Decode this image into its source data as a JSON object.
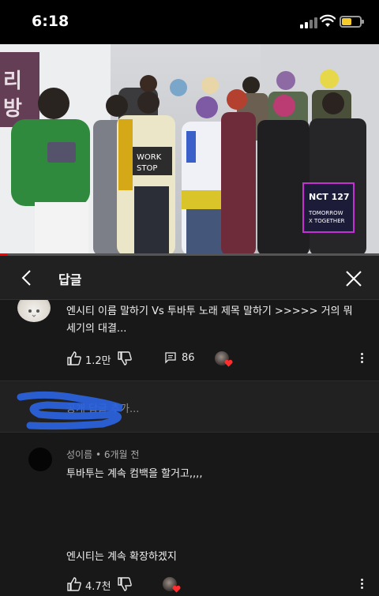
{
  "status_bar": {
    "time": "6:18"
  },
  "video": {
    "progress_fraction": 0.02,
    "sign_lines": [
      "NCT 127",
      "TOMORROW",
      "X TOGETHER"
    ]
  },
  "header": {
    "title": "답글"
  },
  "comment": {
    "text": "엔시티 이름 말하기 Vs 투바투 노래 제목 말하기 >>>>> 거의 뭐 세기의 대결...",
    "likes": "1.2만",
    "replies": "86"
  },
  "reply_box": {
    "placeholder": "공개 답글 추가..."
  },
  "reply": {
    "author": "성이름",
    "time": "6개월 전",
    "line1": "투바투는 계속 컴백을 할거고,,,,",
    "line2": "엔시티는 계속 확장하겠지",
    "likes": "4.7천"
  },
  "colors": {
    "background": "#181818",
    "header": "#212121",
    "progress": "#ff0000",
    "heart": "#ff2d2d"
  }
}
